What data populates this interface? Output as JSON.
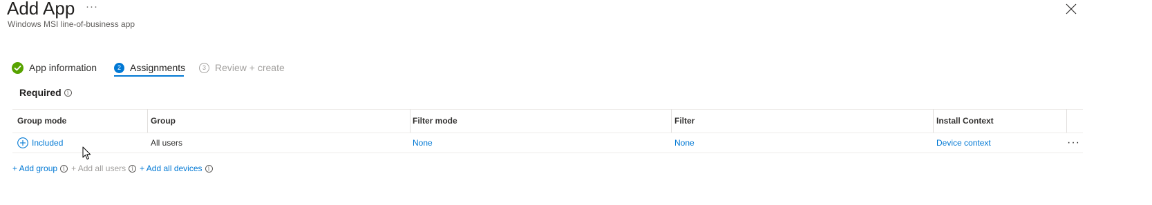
{
  "header": {
    "title": "Add App",
    "more_label": "···",
    "subtitle": "Windows MSI line-of-business app",
    "close_icon": "close-icon"
  },
  "steps": [
    {
      "label": "App information",
      "state": "completed",
      "icon": "check-circle-icon"
    },
    {
      "label": "Assignments",
      "number": "2",
      "state": "active"
    },
    {
      "label": "Review + create",
      "number": "3",
      "state": "disabled"
    }
  ],
  "section": {
    "title": "Required",
    "info_glyph": "i"
  },
  "table": {
    "columns": [
      "Group mode",
      "Group",
      "Filter mode",
      "Filter",
      "Install Context"
    ],
    "rows": [
      {
        "group_mode": "Included",
        "group": "All users",
        "filter_mode": "None",
        "filter": "None",
        "install_context": "Device context",
        "more_label": "···"
      }
    ]
  },
  "actions": {
    "add_group": "+ Add group",
    "add_all_users": "+ Add all users",
    "add_all_devices": "+ Add all devices"
  },
  "colors": {
    "accent": "#0078d4",
    "success": "#57a300",
    "disabled": "#a19f9d",
    "text": "#323130"
  }
}
